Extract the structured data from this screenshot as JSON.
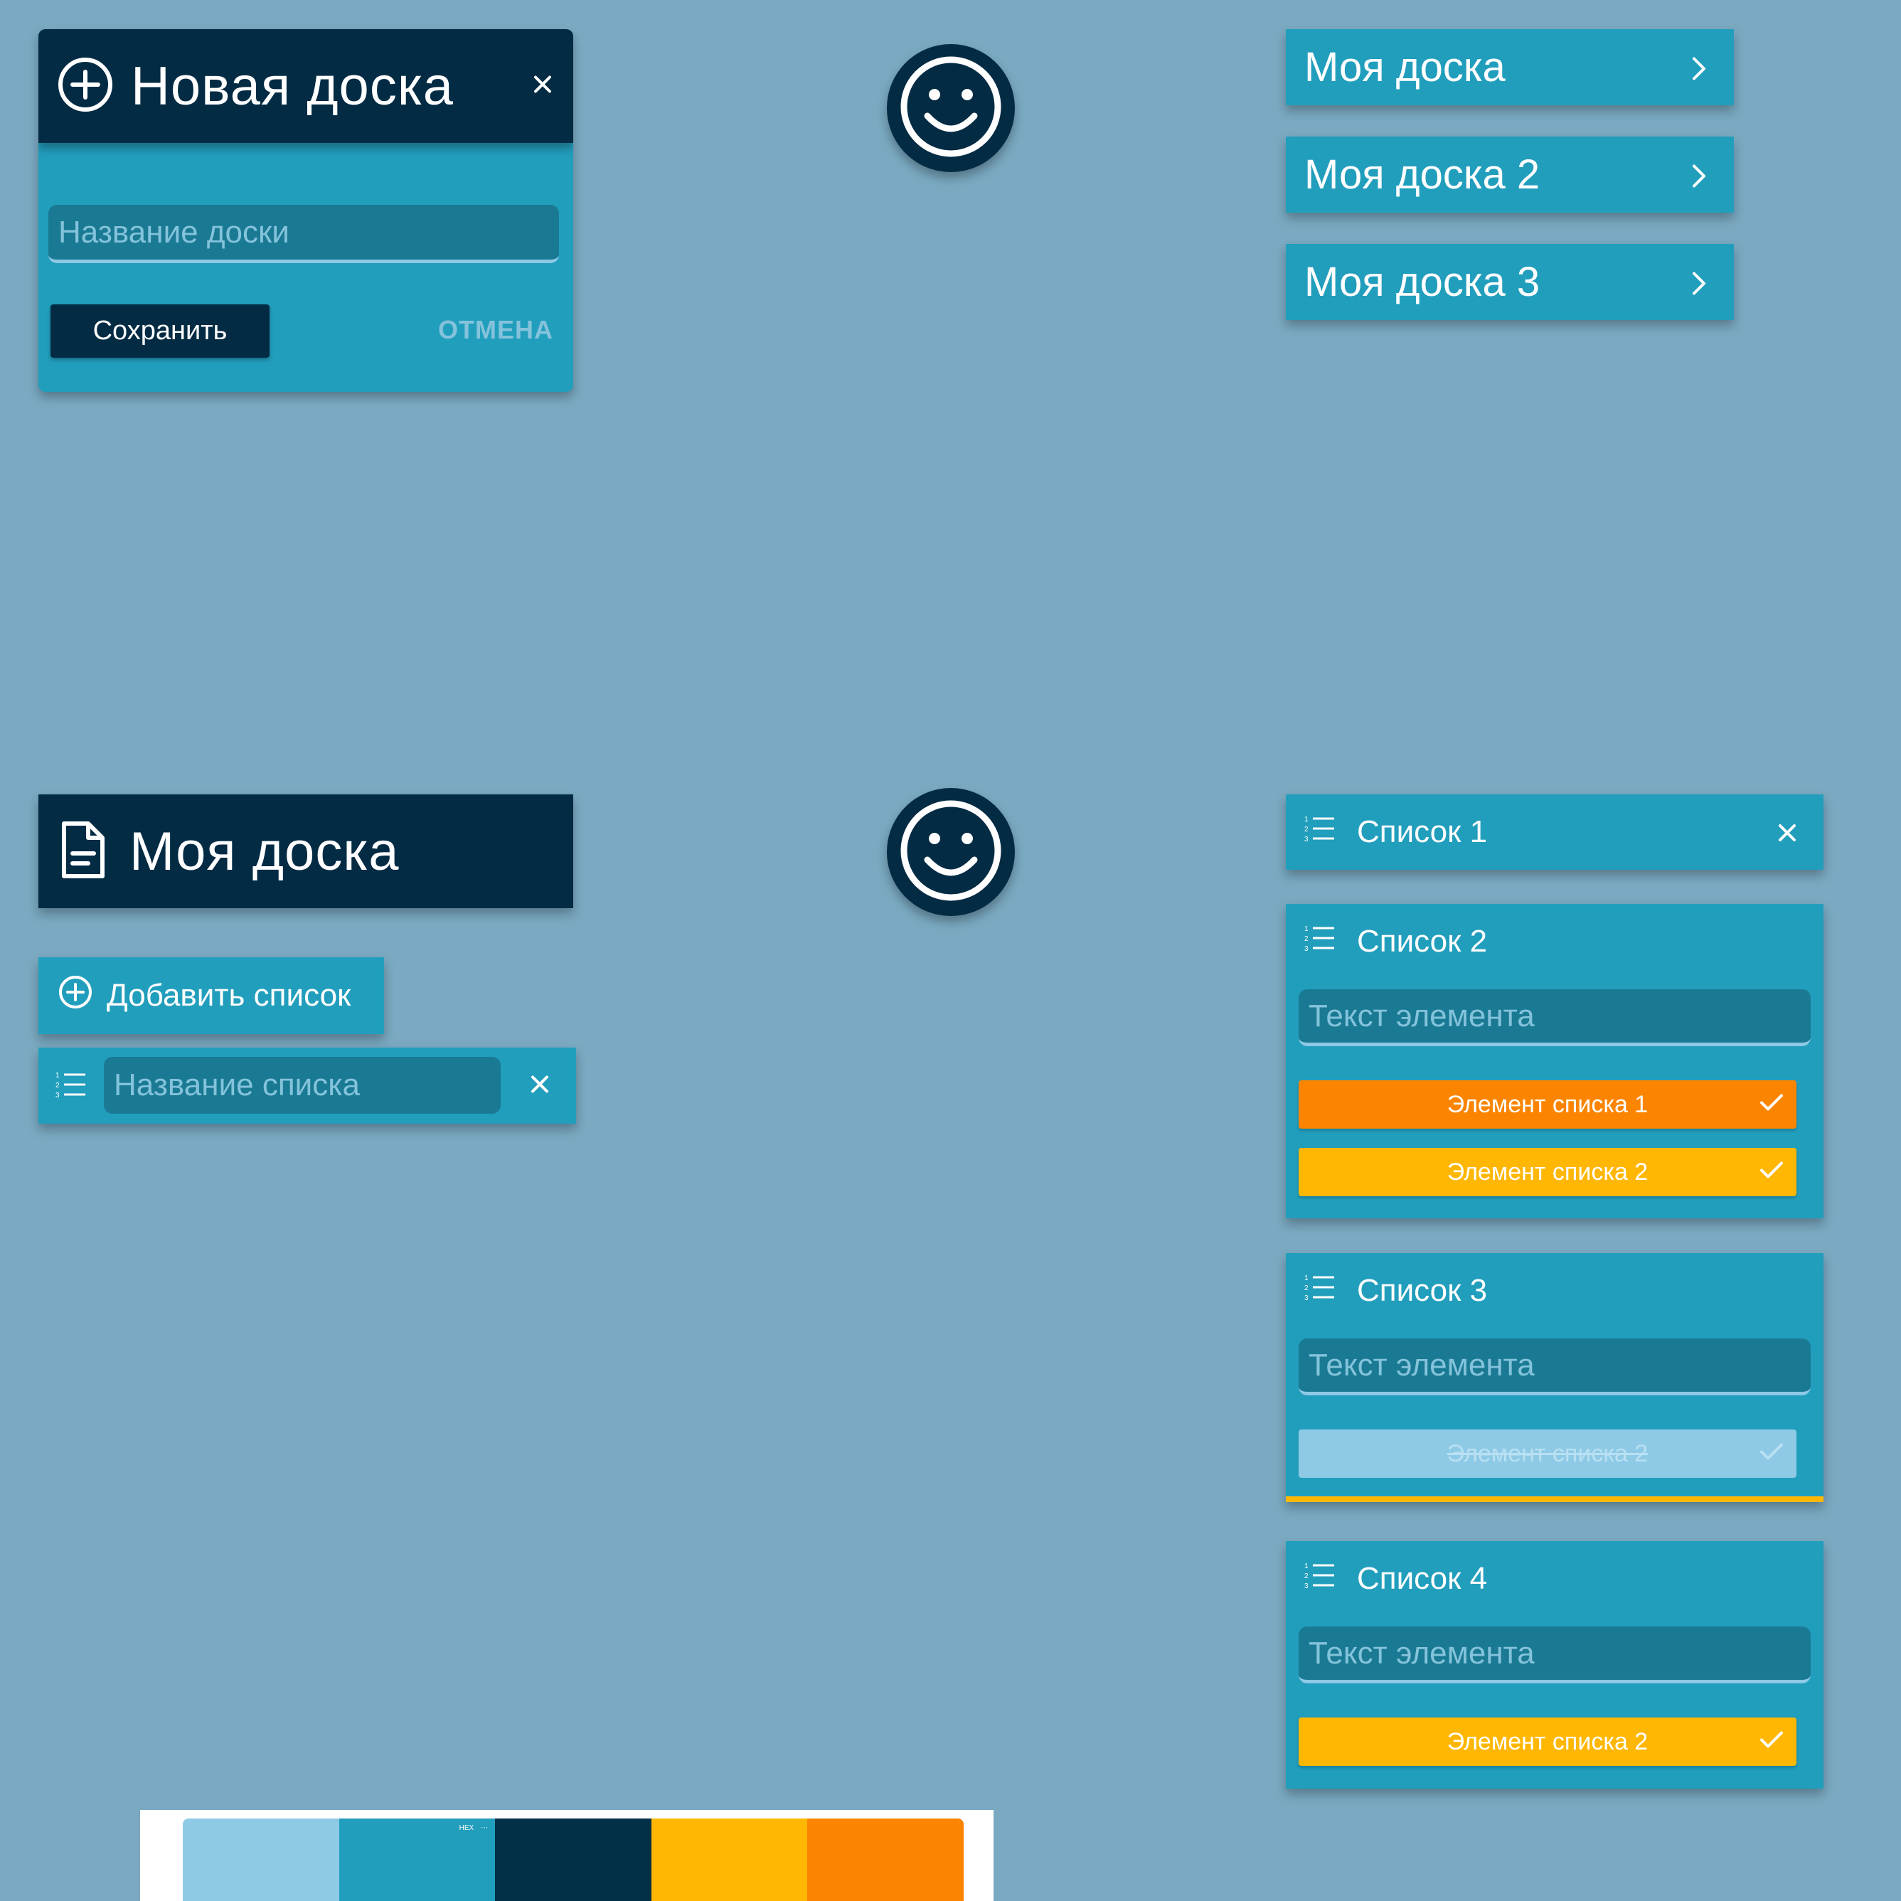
{
  "colors": {
    "background": "#7aa9c1",
    "primary": "#229ebd",
    "dark": "#032b44",
    "light": "#8ecae6",
    "yellow": "#ffb703",
    "orange": "#fb8500"
  },
  "new_board_dialog": {
    "title": "Новая доска",
    "icon": "plus-circle-icon",
    "name_placeholder": "Название доски",
    "save_label": "Сохранить",
    "cancel_label": "ОТМЕНА"
  },
  "boards": [
    {
      "label": "Моя доска"
    },
    {
      "label": "Моя доска 2"
    },
    {
      "label": "Моя доска 3"
    }
  ],
  "board_page": {
    "title": "Моя доска",
    "icon": "document-icon",
    "add_list_label": "Добавить список",
    "list_name_placeholder": "Название списка"
  },
  "lists": [
    {
      "title": "Список 1"
    },
    {
      "title": "Список 2",
      "item_placeholder": "Текст элемента",
      "items": [
        {
          "text": "Элемент списка 1",
          "color": "orange",
          "done": false
        },
        {
          "text": "Элемент списка 2",
          "color": "yellow",
          "done": false
        }
      ]
    },
    {
      "title": "Список 3",
      "item_placeholder": "Текст элемента",
      "items": [
        {
          "text": "Элемент списка 2",
          "color": "light",
          "done": true
        }
      ]
    },
    {
      "title": "Список 4",
      "item_placeholder": "Текст элемента",
      "items": [
        {
          "text": "Элемент списка 2",
          "color": "yellow",
          "done": false
        }
      ]
    }
  ],
  "palette": {
    "swatches": [
      "#8ecae6",
      "#219ebc",
      "#023047",
      "#ffb703",
      "#fb8500"
    ],
    "tools_label": "HEX"
  }
}
